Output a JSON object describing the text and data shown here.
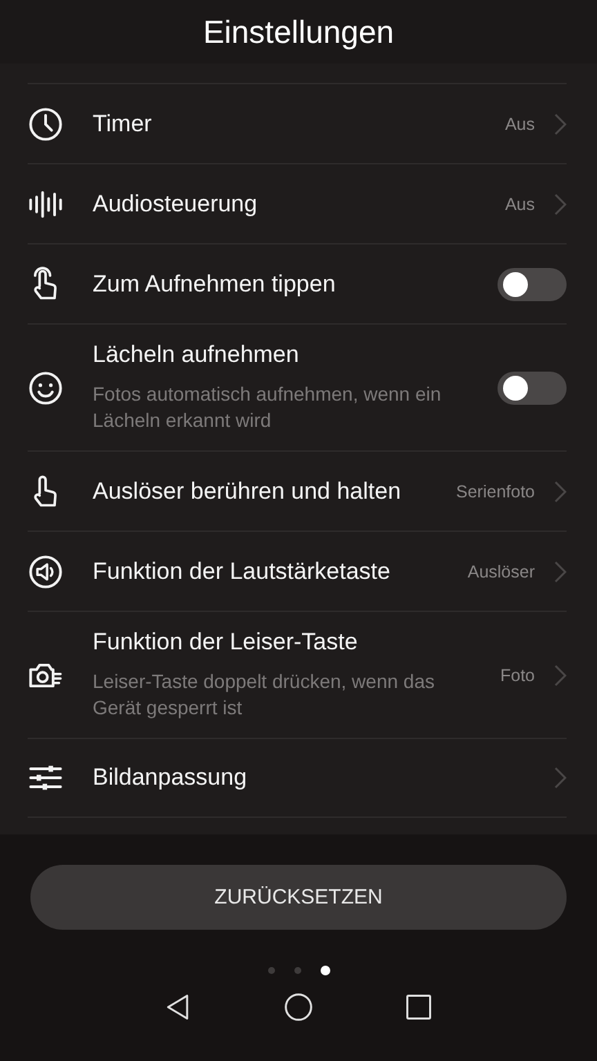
{
  "title": "Einstellungen",
  "settings": [
    {
      "kind": "link",
      "label": "Timer",
      "value": "Aus"
    },
    {
      "kind": "link",
      "label": "Audiosteuerung",
      "value": "Aus"
    },
    {
      "kind": "toggle",
      "label": "Zum Aufnehmen tippen",
      "on": false
    },
    {
      "kind": "toggle",
      "label": "Lächeln aufnehmen",
      "description": "Fotos automatisch aufnehmen, wenn ein Lächeln erkannt wird",
      "on": false
    },
    {
      "kind": "link",
      "label": "Auslöser berühren und halten",
      "value": "Serienfoto"
    },
    {
      "kind": "link",
      "label": "Funktion der Lautstärketaste",
      "value": "Auslöser"
    },
    {
      "kind": "link",
      "label": "Funktion der Leiser-Taste",
      "description": "Leiser-Taste doppelt drücken, wenn das Gerät gesperrt ist",
      "value": "Foto"
    },
    {
      "kind": "link",
      "label": "Bildanpassung"
    }
  ],
  "reset_button": "ZURÜCKSETZEN",
  "page_dots": [
    {
      "selected": false
    },
    {
      "selected": false
    },
    {
      "selected": true
    }
  ]
}
